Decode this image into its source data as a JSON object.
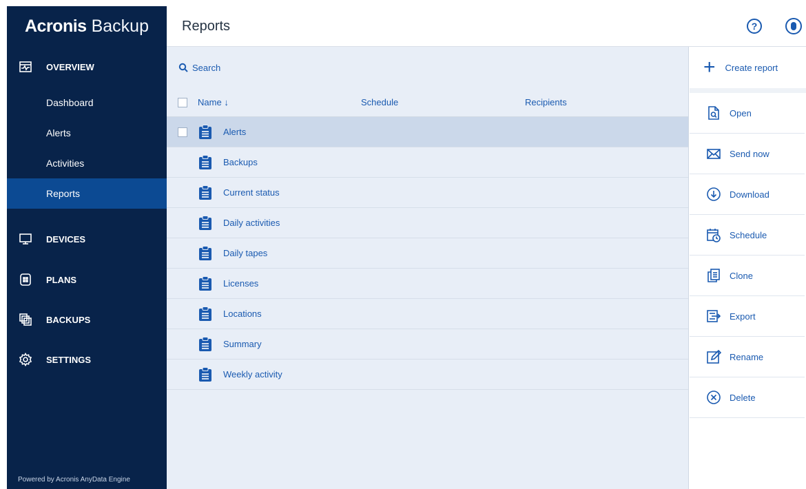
{
  "brand": {
    "name_bold": "Acronis",
    "name_light": "Backup"
  },
  "sidebar": {
    "sections": [
      {
        "label": "OVERVIEW",
        "icon": "overview-icon"
      },
      {
        "label": "DEVICES",
        "icon": "monitor-icon"
      },
      {
        "label": "PLANS",
        "icon": "plans-icon"
      },
      {
        "label": "BACKUPS",
        "icon": "backups-icon"
      },
      {
        "label": "SETTINGS",
        "icon": "gear-icon"
      }
    ],
    "subitems": [
      {
        "label": "Dashboard"
      },
      {
        "label": "Alerts"
      },
      {
        "label": "Activities"
      },
      {
        "label": "Reports",
        "active": true
      }
    ],
    "footer": "Powered by Acronis AnyData Engine"
  },
  "header": {
    "title": "Reports",
    "help_label": "?"
  },
  "search": {
    "placeholder": "Search"
  },
  "table": {
    "columns": [
      "Name",
      "Schedule",
      "Recipients"
    ],
    "sort_indicator": "↓",
    "rows": [
      {
        "name": "Alerts",
        "selected": true
      },
      {
        "name": "Backups"
      },
      {
        "name": "Current status"
      },
      {
        "name": "Daily activities"
      },
      {
        "name": "Daily tapes"
      },
      {
        "name": "Licenses"
      },
      {
        "name": "Locations"
      },
      {
        "name": "Summary"
      },
      {
        "name": "Weekly activity"
      }
    ]
  },
  "actions": {
    "create": "Create report",
    "items": [
      {
        "label": "Open",
        "icon": "open-icon"
      },
      {
        "label": "Send now",
        "icon": "envelope-icon"
      },
      {
        "label": "Download",
        "icon": "download-icon"
      },
      {
        "label": "Schedule",
        "icon": "calendar-clock-icon"
      },
      {
        "label": "Clone",
        "icon": "clone-icon"
      },
      {
        "label": "Export",
        "icon": "export-icon"
      },
      {
        "label": "Rename",
        "icon": "rename-icon"
      },
      {
        "label": "Delete",
        "icon": "delete-icon"
      }
    ]
  },
  "colors": {
    "sidebar_bg": "#08234a",
    "active_item": "#0c4a93",
    "accent": "#1a5ab0",
    "list_bg": "#e8eef7",
    "selected_row": "#cbd8ea"
  }
}
